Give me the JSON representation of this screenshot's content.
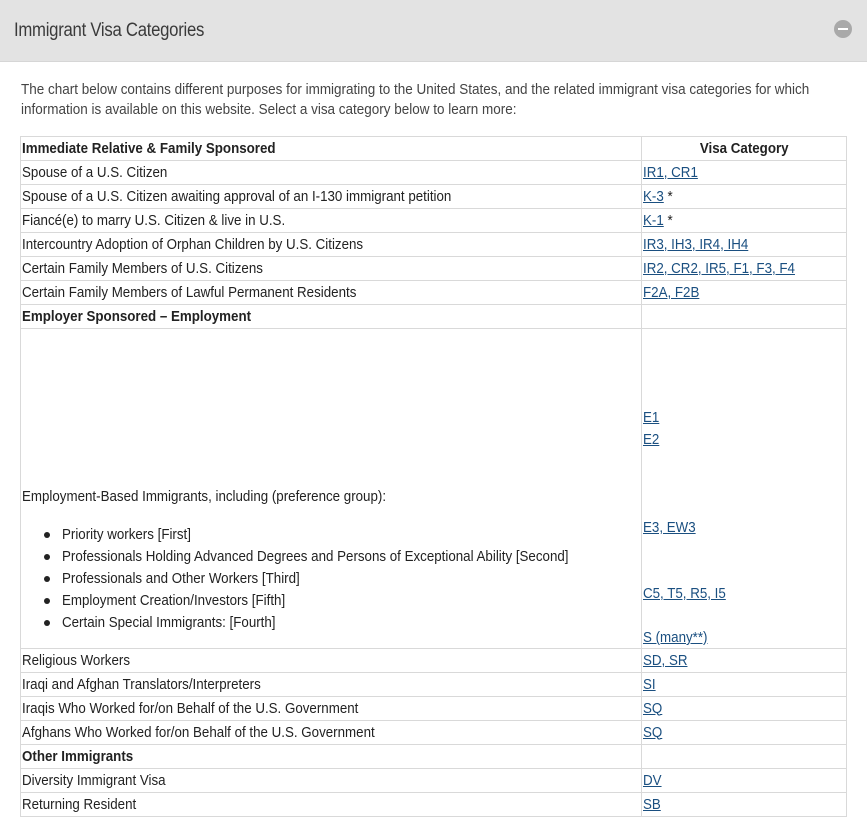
{
  "panel": {
    "title": "Immigrant Visa Categories",
    "collapse_icon": "minus-circle-icon"
  },
  "intro": "The chart below contains different purposes for immigrating to the United States, and the related immigrant visa categories for which information is available on this website. Select a visa category below to learn more:",
  "table": {
    "header_left": "Immediate Relative & Family Sponsored",
    "header_right": "Visa Category",
    "family_rows": [
      {
        "purpose": "Spouse of a U.S. Citizen",
        "links": "IR1, CR1",
        "suffix": ""
      },
      {
        "purpose": "Spouse of a U.S. Citizen awaiting approval of an I-130 immigrant petition",
        "links": "K-3",
        "suffix": " *"
      },
      {
        "purpose": "Fiancé(e) to marry U.S. Citizen & live in U.S.",
        "links": "K-1",
        "suffix": " *"
      },
      {
        "purpose": "Intercountry Adoption of Orphan Children by U.S. Citizens",
        "links": "IR3, IH3, IR4, IH4",
        "suffix": ""
      },
      {
        "purpose": "Certain Family Members of U.S. Citizens",
        "links": "IR2, CR2, IR5, F1, F3, F4",
        "suffix": ""
      },
      {
        "purpose": "Certain Family Members of Lawful Permanent Residents",
        "links": "F2A, F2B",
        "suffix": ""
      }
    ],
    "employer_section": "Employer Sponsored – Employment",
    "employment": {
      "intro": "Employment-Based Immigrants, including  (preference group):",
      "items": [
        "Priority workers [First]",
        "Professionals Holding Advanced Degrees and Persons of Exceptional Ability [Second]",
        "Professionals and Other Workers [Third]",
        "Employment Creation/Investors [Fifth]",
        "Certain Special Immigrants: [Fourth]"
      ],
      "links": [
        "E1",
        "E2",
        "E3, EW3",
        "C5, T5, R5, I5",
        "S (many**)"
      ]
    },
    "employer_rows": [
      {
        "purpose": "Religious Workers",
        "links": "SD, SR"
      },
      {
        "purpose": "Iraqi and Afghan Translators/Interpreters",
        "links": "SI"
      },
      {
        "purpose": "Iraqis Who Worked for/on Behalf of the U.S. Government",
        "links": "SQ"
      },
      {
        "purpose": "Afghans Who Worked for/on Behalf of the U.S. Government",
        "links": "SQ"
      }
    ],
    "other_section": "Other Immigrants",
    "other_rows": [
      {
        "purpose": "Diversity Immigrant Visa",
        "links": "DV"
      },
      {
        "purpose": "Returning Resident",
        "links": "SB"
      }
    ]
  },
  "colors": {
    "header_bg": "#e3e3e3",
    "link": "#1a4f80",
    "border": "#d9d9d9"
  }
}
